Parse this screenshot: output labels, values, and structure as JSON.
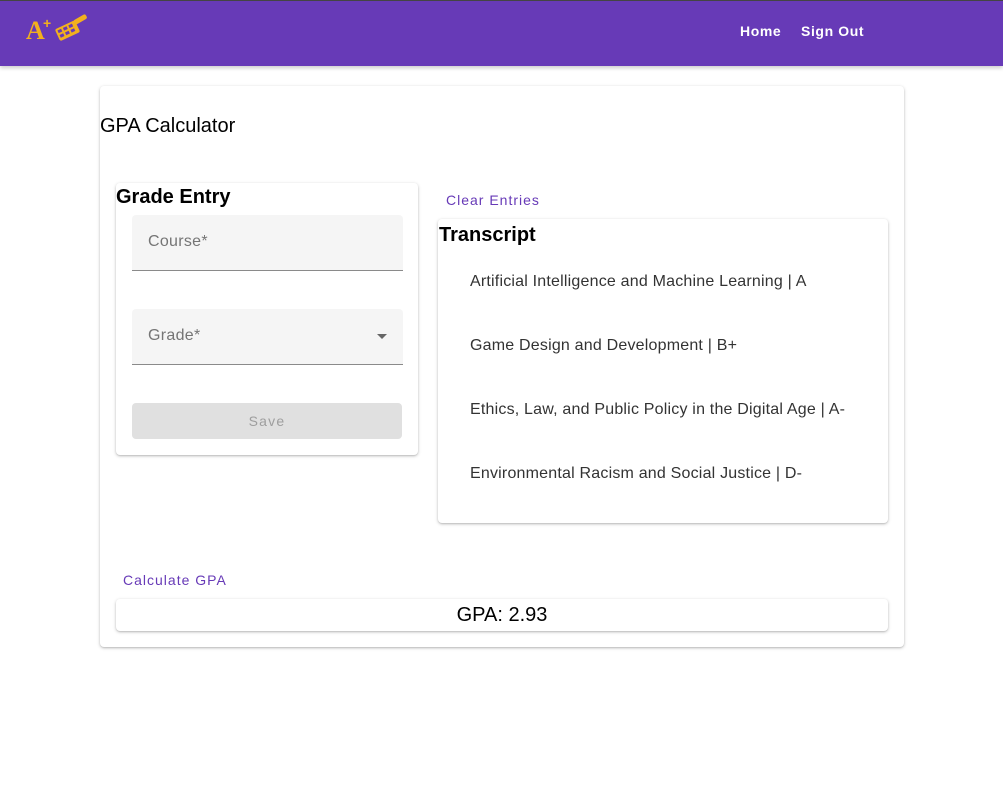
{
  "header": {
    "logo_icon": "a-plus-calculator-logo",
    "nav": {
      "home_label": "Home",
      "signout_label": "Sign Out"
    },
    "bg_color": "#673ab7"
  },
  "main": {
    "title": "GPA Calculator",
    "grade_entry": {
      "title": "Grade Entry",
      "course_placeholder": "Course*",
      "grade_placeholder": "Grade*",
      "save_label": "Save"
    },
    "clear_label": "Clear Entries",
    "transcript": {
      "title": "Transcript",
      "items": [
        "Artificial Intelligence and Machine Learning | A",
        "Game Design and Development | B+",
        "Ethics, Law, and Public Policy in the Digital Age | A-",
        "Environmental Racism and Social Justice | D-"
      ]
    },
    "calculate_label": "Calculate GPA",
    "gpa_text": "GPA: 2.93"
  }
}
